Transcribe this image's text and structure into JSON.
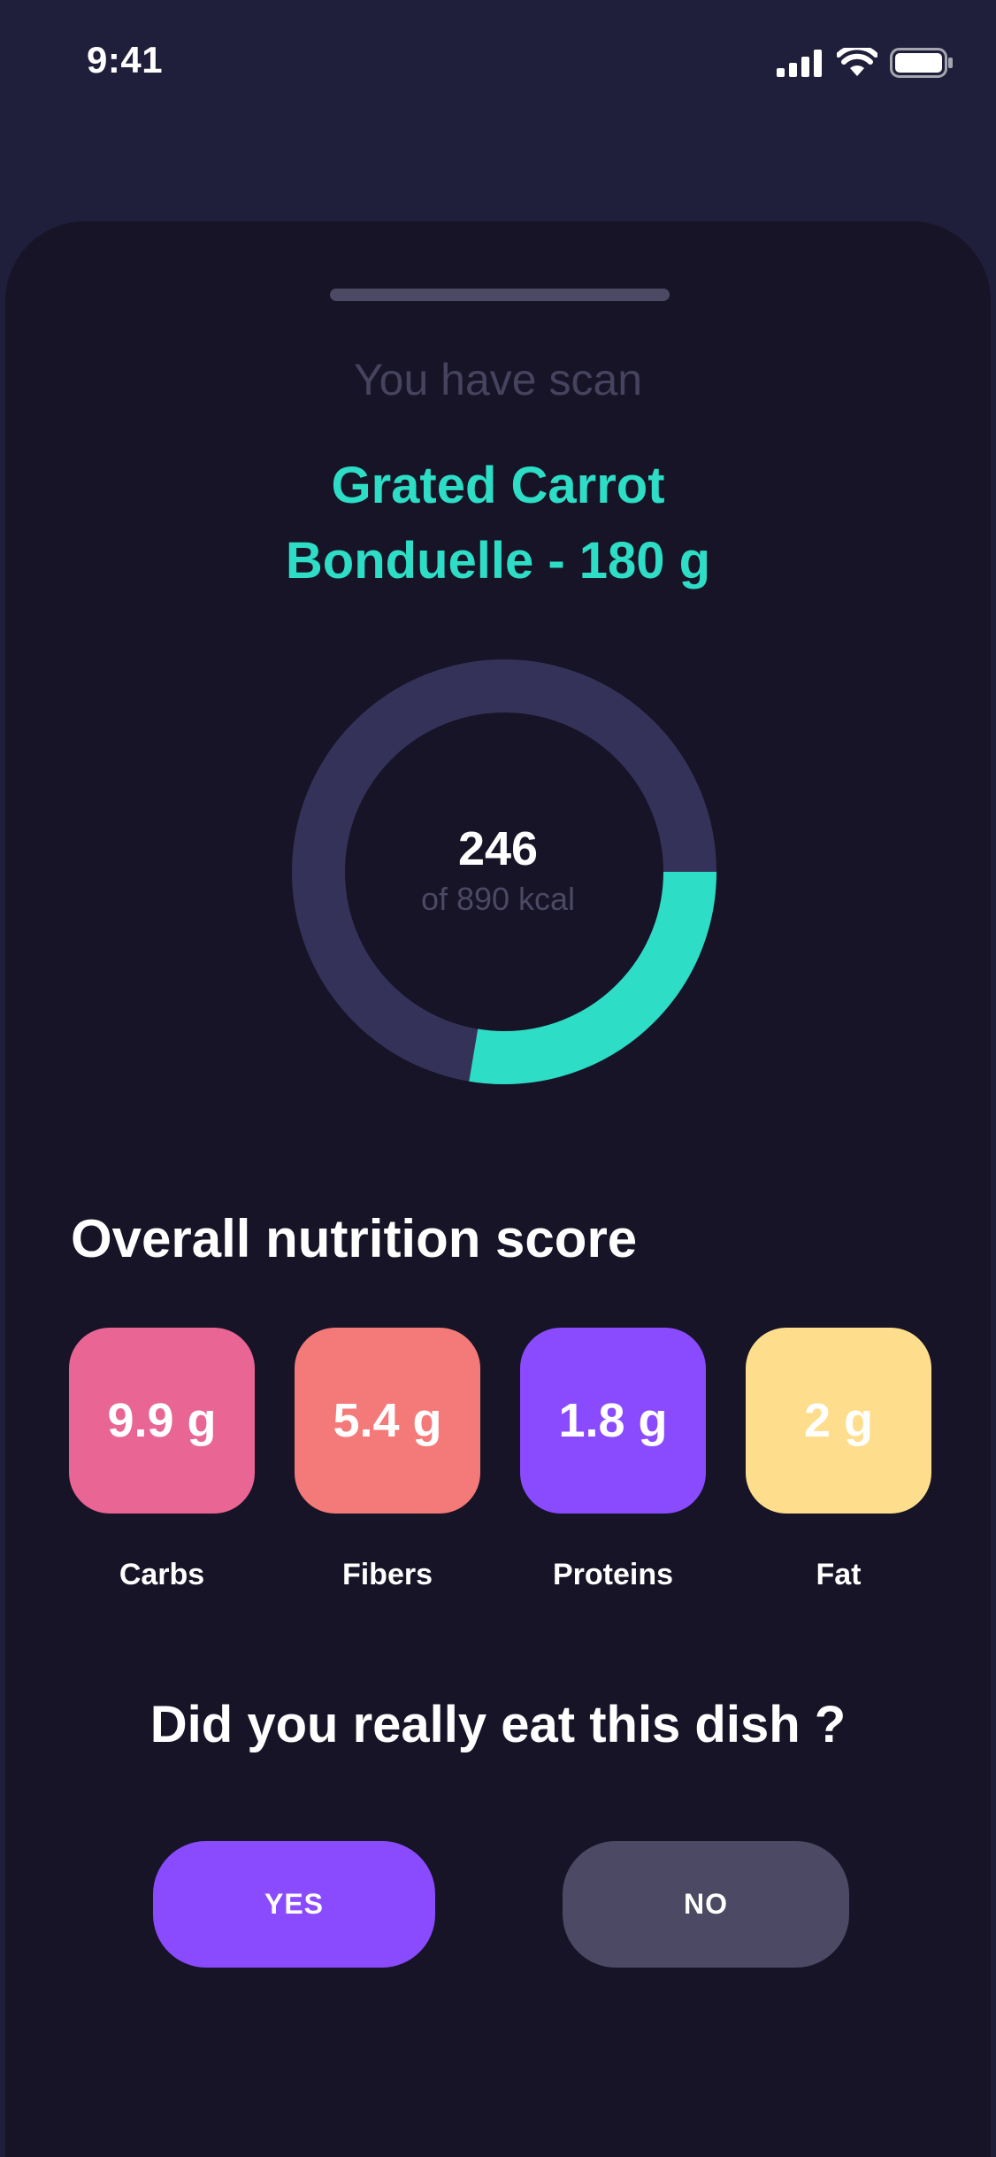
{
  "status": {
    "time": "9:41"
  },
  "scan": {
    "subtitle": "You have scan",
    "product_line1": "Grated Carrot",
    "product_line2": "Bonduelle - 180 g"
  },
  "calories": {
    "value": "246",
    "total_label": "of 890 kcal",
    "consumed": 246,
    "goal": 890
  },
  "nutrition": {
    "title": "Overall nutrition score",
    "items": [
      {
        "value": "9.9 g",
        "label": "Carbs",
        "color": "#e96593"
      },
      {
        "value": "5.4 g",
        "label": "Fibers",
        "color": "#f47a79"
      },
      {
        "value": "1.8 g",
        "label": "Proteins",
        "color": "#8a4bff"
      },
      {
        "value": "2 g",
        "label": "Fat",
        "color": "#fede8c"
      }
    ]
  },
  "confirm": {
    "question": "Did you really eat this dish ?",
    "yes_label": "YES",
    "no_label": "NO"
  },
  "colors": {
    "accent_teal": "#2dddc5",
    "ring_track": "#35325a",
    "background": "#161426"
  },
  "icons": [
    "signal-icon",
    "wifi-icon",
    "battery-icon"
  ]
}
